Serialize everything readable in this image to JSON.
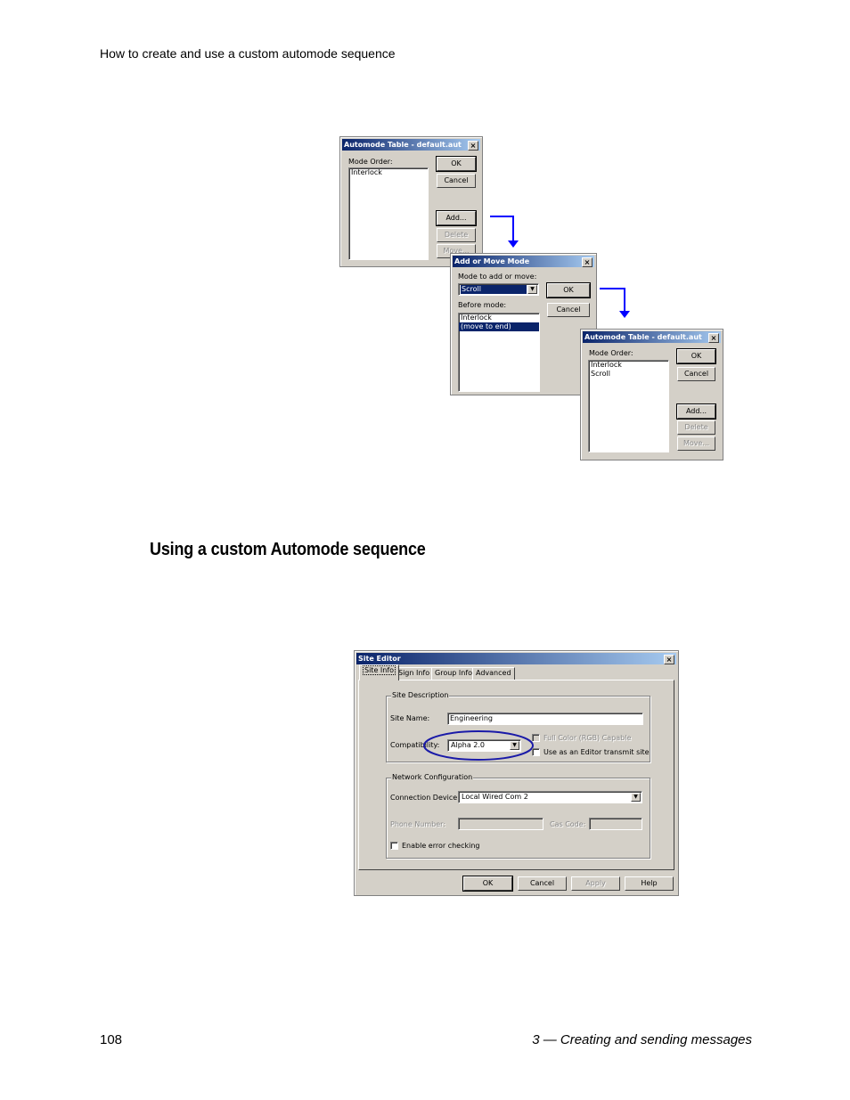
{
  "page": {
    "running_head": "How to create and use a custom automode sequence",
    "section_heading": "Using a custom Automode sequence",
    "page_number": "108",
    "chapter_footer": "3 — Creating and sending messages"
  },
  "colors": {
    "titlebar_start": "#0a246a",
    "titlebar_end": "#a6caf0",
    "flow_arrow": "#0000ff",
    "highlight_ellipse": "#1a1aa8"
  },
  "automode_table_1": {
    "title": "Automode Table - default.aut",
    "close": "×",
    "mode_order_label": "Mode Order:",
    "items": [
      "Interlock"
    ],
    "ok": "OK",
    "cancel": "Cancel",
    "add": "Add...",
    "delete": "Delete",
    "move": "Move..."
  },
  "add_move_mode": {
    "title": "Add or Move Mode",
    "close": "×",
    "mode_label": "Mode to add or move:",
    "mode_value": "Scroll",
    "before_label": "Before mode:",
    "items": [
      "Interlock",
      "(move to end)"
    ],
    "ok": "OK",
    "cancel": "Cancel"
  },
  "automode_table_2": {
    "title": "Automode Table - default.aut",
    "close": "×",
    "mode_order_label": "Mode Order:",
    "items": [
      "Interlock",
      "Scroll"
    ],
    "ok": "OK",
    "cancel": "Cancel",
    "add": "Add...",
    "delete": "Delete",
    "move": "Move..."
  },
  "site_editor": {
    "title": "Site Editor",
    "close": "×",
    "tabs": [
      "Site Info",
      "Sign Info",
      "Group Info",
      "Advanced"
    ],
    "site_description": {
      "group_label": "Site Description",
      "site_name_label": "Site Name:",
      "site_name_value": "Engineering",
      "compatibility_label": "Compatibility:",
      "compatibility_value": "Alpha 2.0",
      "full_color_label": "Full Color (RGB) Capable",
      "editor_transmit_label": "Use as an Editor transmit site"
    },
    "network": {
      "group_label": "Network Configuration",
      "connection_label": "Connection Device:",
      "connection_value": "Local Wired Com 2",
      "phone_label": "Phone Number:",
      "cas_label": "Cas Code:",
      "error_check_label": "Enable error checking"
    },
    "ok": "OK",
    "cancel": "Cancel",
    "apply": "Apply",
    "help": "Help"
  }
}
